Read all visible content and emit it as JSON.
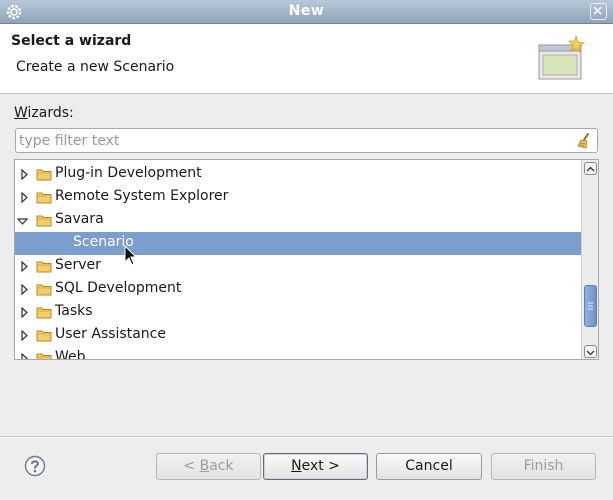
{
  "window": {
    "title": "New"
  },
  "header": {
    "title": "Select a wizard",
    "description": "Create a new Scenario"
  },
  "wizards_label": {
    "prefix": "W",
    "rest": "izards:"
  },
  "filter": {
    "placeholder": "type filter text",
    "value": ""
  },
  "tree": {
    "items": [
      {
        "label": "Plug-in Development",
        "expanded": false,
        "selected": false,
        "icon": "folder-icon"
      },
      {
        "label": "Remote System Explorer",
        "expanded": false,
        "selected": false,
        "icon": "folder-icon"
      },
      {
        "label": "Savara",
        "expanded": true,
        "selected": false,
        "icon": "folder-open-icon"
      },
      {
        "label": "Scenario",
        "expanded": false,
        "selected": true,
        "icon": "scenario-icon"
      },
      {
        "label": "Server",
        "expanded": false,
        "selected": false,
        "icon": "folder-icon"
      },
      {
        "label": "SQL Development",
        "expanded": false,
        "selected": false,
        "icon": "folder-icon"
      },
      {
        "label": "Tasks",
        "expanded": false,
        "selected": false,
        "icon": "folder-icon"
      },
      {
        "label": "User Assistance",
        "expanded": false,
        "selected": false,
        "icon": "folder-icon"
      },
      {
        "label": "Web",
        "expanded": false,
        "selected": false,
        "icon": "folder-icon"
      }
    ]
  },
  "buttons": {
    "back": {
      "prefix": "< ",
      "mnemonic": "B",
      "rest": "ack",
      "enabled": false
    },
    "next": {
      "mnemonic": "N",
      "rest": "ext >",
      "enabled": true
    },
    "cancel": {
      "label": "Cancel",
      "enabled": true
    },
    "finish": {
      "label": "Finish",
      "enabled": false
    }
  },
  "colors": {
    "selection": "#7b9ecf",
    "titlebar": "#9fb2c6"
  }
}
